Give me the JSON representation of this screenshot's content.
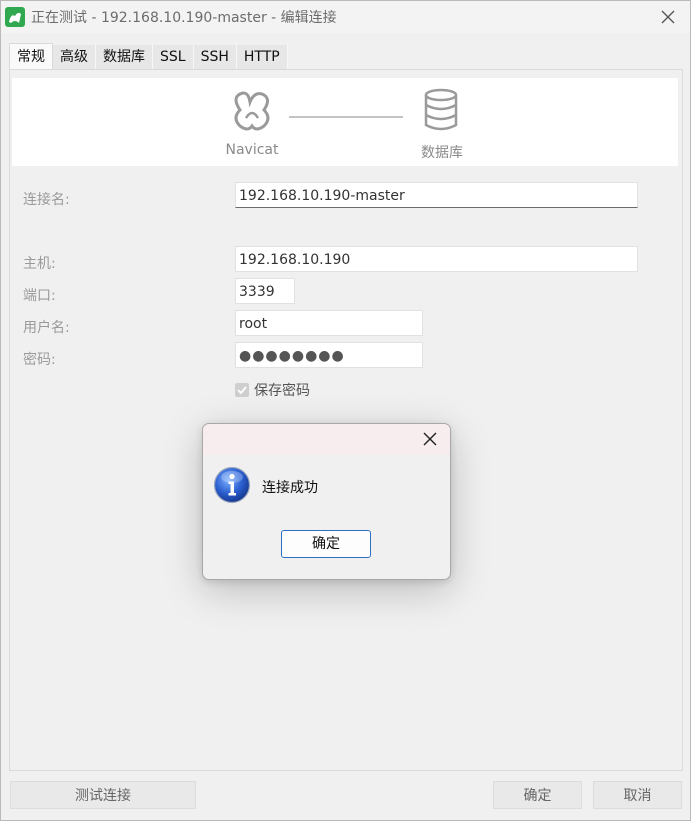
{
  "window": {
    "title": "正在测试 - 192.168.10.190-master - 编辑连接"
  },
  "tabs": [
    {
      "label": "常规",
      "active": true
    },
    {
      "label": "高级"
    },
    {
      "label": "数据库"
    },
    {
      "label": "SSL"
    },
    {
      "label": "SSH"
    },
    {
      "label": "HTTP"
    }
  ],
  "header": {
    "left_label": "Navicat",
    "left_icon": "navicat-icon",
    "right_label": "数据库",
    "right_icon": "database-icon"
  },
  "form": {
    "connection_name": {
      "label": "连接名:",
      "value": "192.168.10.190-master"
    },
    "host": {
      "label": "主机:",
      "value": "192.168.10.190"
    },
    "port": {
      "label": "端口:",
      "value": "3339"
    },
    "username": {
      "label": "用户名:",
      "value": "root"
    },
    "password": {
      "label": "密码:",
      "value": "●●●●●●●●"
    },
    "save_password": {
      "label": "保存密码",
      "checked": true
    }
  },
  "footer": {
    "test_button": "测试连接",
    "ok_button": "确定",
    "cancel_button": "取消"
  },
  "dialog": {
    "icon": "info-icon",
    "message": "连接成功",
    "ok_button": "确定"
  },
  "colors": {
    "app_icon": "#2fa84f",
    "modal_title_bg": "#f7ecee",
    "modal_ok_border": "#2d6fbf"
  }
}
